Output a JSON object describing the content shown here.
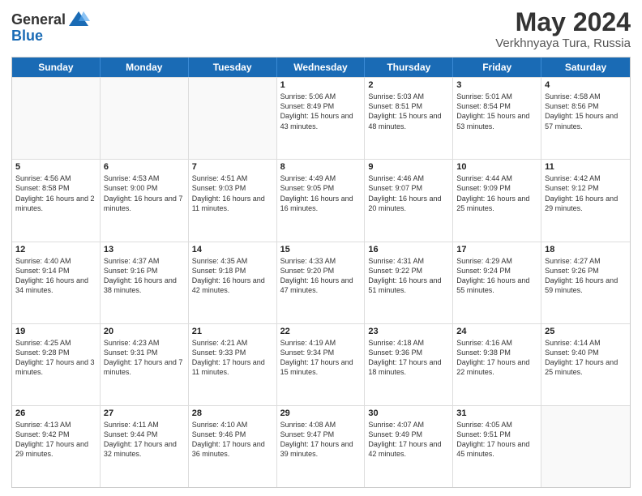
{
  "header": {
    "logo_line1": "General",
    "logo_line2": "Blue",
    "month_year": "May 2024",
    "location": "Verkhnyaya Tura, Russia"
  },
  "weekdays": [
    "Sunday",
    "Monday",
    "Tuesday",
    "Wednesday",
    "Thursday",
    "Friday",
    "Saturday"
  ],
  "rows": [
    [
      {
        "day": "",
        "sunrise": "",
        "sunset": "",
        "daylight": ""
      },
      {
        "day": "",
        "sunrise": "",
        "sunset": "",
        "daylight": ""
      },
      {
        "day": "",
        "sunrise": "",
        "sunset": "",
        "daylight": ""
      },
      {
        "day": "1",
        "sunrise": "Sunrise: 5:06 AM",
        "sunset": "Sunset: 8:49 PM",
        "daylight": "Daylight: 15 hours and 43 minutes."
      },
      {
        "day": "2",
        "sunrise": "Sunrise: 5:03 AM",
        "sunset": "Sunset: 8:51 PM",
        "daylight": "Daylight: 15 hours and 48 minutes."
      },
      {
        "day": "3",
        "sunrise": "Sunrise: 5:01 AM",
        "sunset": "Sunset: 8:54 PM",
        "daylight": "Daylight: 15 hours and 53 minutes."
      },
      {
        "day": "4",
        "sunrise": "Sunrise: 4:58 AM",
        "sunset": "Sunset: 8:56 PM",
        "daylight": "Daylight: 15 hours and 57 minutes."
      }
    ],
    [
      {
        "day": "5",
        "sunrise": "Sunrise: 4:56 AM",
        "sunset": "Sunset: 8:58 PM",
        "daylight": "Daylight: 16 hours and 2 minutes."
      },
      {
        "day": "6",
        "sunrise": "Sunrise: 4:53 AM",
        "sunset": "Sunset: 9:00 PM",
        "daylight": "Daylight: 16 hours and 7 minutes."
      },
      {
        "day": "7",
        "sunrise": "Sunrise: 4:51 AM",
        "sunset": "Sunset: 9:03 PM",
        "daylight": "Daylight: 16 hours and 11 minutes."
      },
      {
        "day": "8",
        "sunrise": "Sunrise: 4:49 AM",
        "sunset": "Sunset: 9:05 PM",
        "daylight": "Daylight: 16 hours and 16 minutes."
      },
      {
        "day": "9",
        "sunrise": "Sunrise: 4:46 AM",
        "sunset": "Sunset: 9:07 PM",
        "daylight": "Daylight: 16 hours and 20 minutes."
      },
      {
        "day": "10",
        "sunrise": "Sunrise: 4:44 AM",
        "sunset": "Sunset: 9:09 PM",
        "daylight": "Daylight: 16 hours and 25 minutes."
      },
      {
        "day": "11",
        "sunrise": "Sunrise: 4:42 AM",
        "sunset": "Sunset: 9:12 PM",
        "daylight": "Daylight: 16 hours and 29 minutes."
      }
    ],
    [
      {
        "day": "12",
        "sunrise": "Sunrise: 4:40 AM",
        "sunset": "Sunset: 9:14 PM",
        "daylight": "Daylight: 16 hours and 34 minutes."
      },
      {
        "day": "13",
        "sunrise": "Sunrise: 4:37 AM",
        "sunset": "Sunset: 9:16 PM",
        "daylight": "Daylight: 16 hours and 38 minutes."
      },
      {
        "day": "14",
        "sunrise": "Sunrise: 4:35 AM",
        "sunset": "Sunset: 9:18 PM",
        "daylight": "Daylight: 16 hours and 42 minutes."
      },
      {
        "day": "15",
        "sunrise": "Sunrise: 4:33 AM",
        "sunset": "Sunset: 9:20 PM",
        "daylight": "Daylight: 16 hours and 47 minutes."
      },
      {
        "day": "16",
        "sunrise": "Sunrise: 4:31 AM",
        "sunset": "Sunset: 9:22 PM",
        "daylight": "Daylight: 16 hours and 51 minutes."
      },
      {
        "day": "17",
        "sunrise": "Sunrise: 4:29 AM",
        "sunset": "Sunset: 9:24 PM",
        "daylight": "Daylight: 16 hours and 55 minutes."
      },
      {
        "day": "18",
        "sunrise": "Sunrise: 4:27 AM",
        "sunset": "Sunset: 9:26 PM",
        "daylight": "Daylight: 16 hours and 59 minutes."
      }
    ],
    [
      {
        "day": "19",
        "sunrise": "Sunrise: 4:25 AM",
        "sunset": "Sunset: 9:28 PM",
        "daylight": "Daylight: 17 hours and 3 minutes."
      },
      {
        "day": "20",
        "sunrise": "Sunrise: 4:23 AM",
        "sunset": "Sunset: 9:31 PM",
        "daylight": "Daylight: 17 hours and 7 minutes."
      },
      {
        "day": "21",
        "sunrise": "Sunrise: 4:21 AM",
        "sunset": "Sunset: 9:33 PM",
        "daylight": "Daylight: 17 hours and 11 minutes."
      },
      {
        "day": "22",
        "sunrise": "Sunrise: 4:19 AM",
        "sunset": "Sunset: 9:34 PM",
        "daylight": "Daylight: 17 hours and 15 minutes."
      },
      {
        "day": "23",
        "sunrise": "Sunrise: 4:18 AM",
        "sunset": "Sunset: 9:36 PM",
        "daylight": "Daylight: 17 hours and 18 minutes."
      },
      {
        "day": "24",
        "sunrise": "Sunrise: 4:16 AM",
        "sunset": "Sunset: 9:38 PM",
        "daylight": "Daylight: 17 hours and 22 minutes."
      },
      {
        "day": "25",
        "sunrise": "Sunrise: 4:14 AM",
        "sunset": "Sunset: 9:40 PM",
        "daylight": "Daylight: 17 hours and 25 minutes."
      }
    ],
    [
      {
        "day": "26",
        "sunrise": "Sunrise: 4:13 AM",
        "sunset": "Sunset: 9:42 PM",
        "daylight": "Daylight: 17 hours and 29 minutes."
      },
      {
        "day": "27",
        "sunrise": "Sunrise: 4:11 AM",
        "sunset": "Sunset: 9:44 PM",
        "daylight": "Daylight: 17 hours and 32 minutes."
      },
      {
        "day": "28",
        "sunrise": "Sunrise: 4:10 AM",
        "sunset": "Sunset: 9:46 PM",
        "daylight": "Daylight: 17 hours and 36 minutes."
      },
      {
        "day": "29",
        "sunrise": "Sunrise: 4:08 AM",
        "sunset": "Sunset: 9:47 PM",
        "daylight": "Daylight: 17 hours and 39 minutes."
      },
      {
        "day": "30",
        "sunrise": "Sunrise: 4:07 AM",
        "sunset": "Sunset: 9:49 PM",
        "daylight": "Daylight: 17 hours and 42 minutes."
      },
      {
        "day": "31",
        "sunrise": "Sunrise: 4:05 AM",
        "sunset": "Sunset: 9:51 PM",
        "daylight": "Daylight: 17 hours and 45 minutes."
      },
      {
        "day": "",
        "sunrise": "",
        "sunset": "",
        "daylight": ""
      }
    ]
  ]
}
